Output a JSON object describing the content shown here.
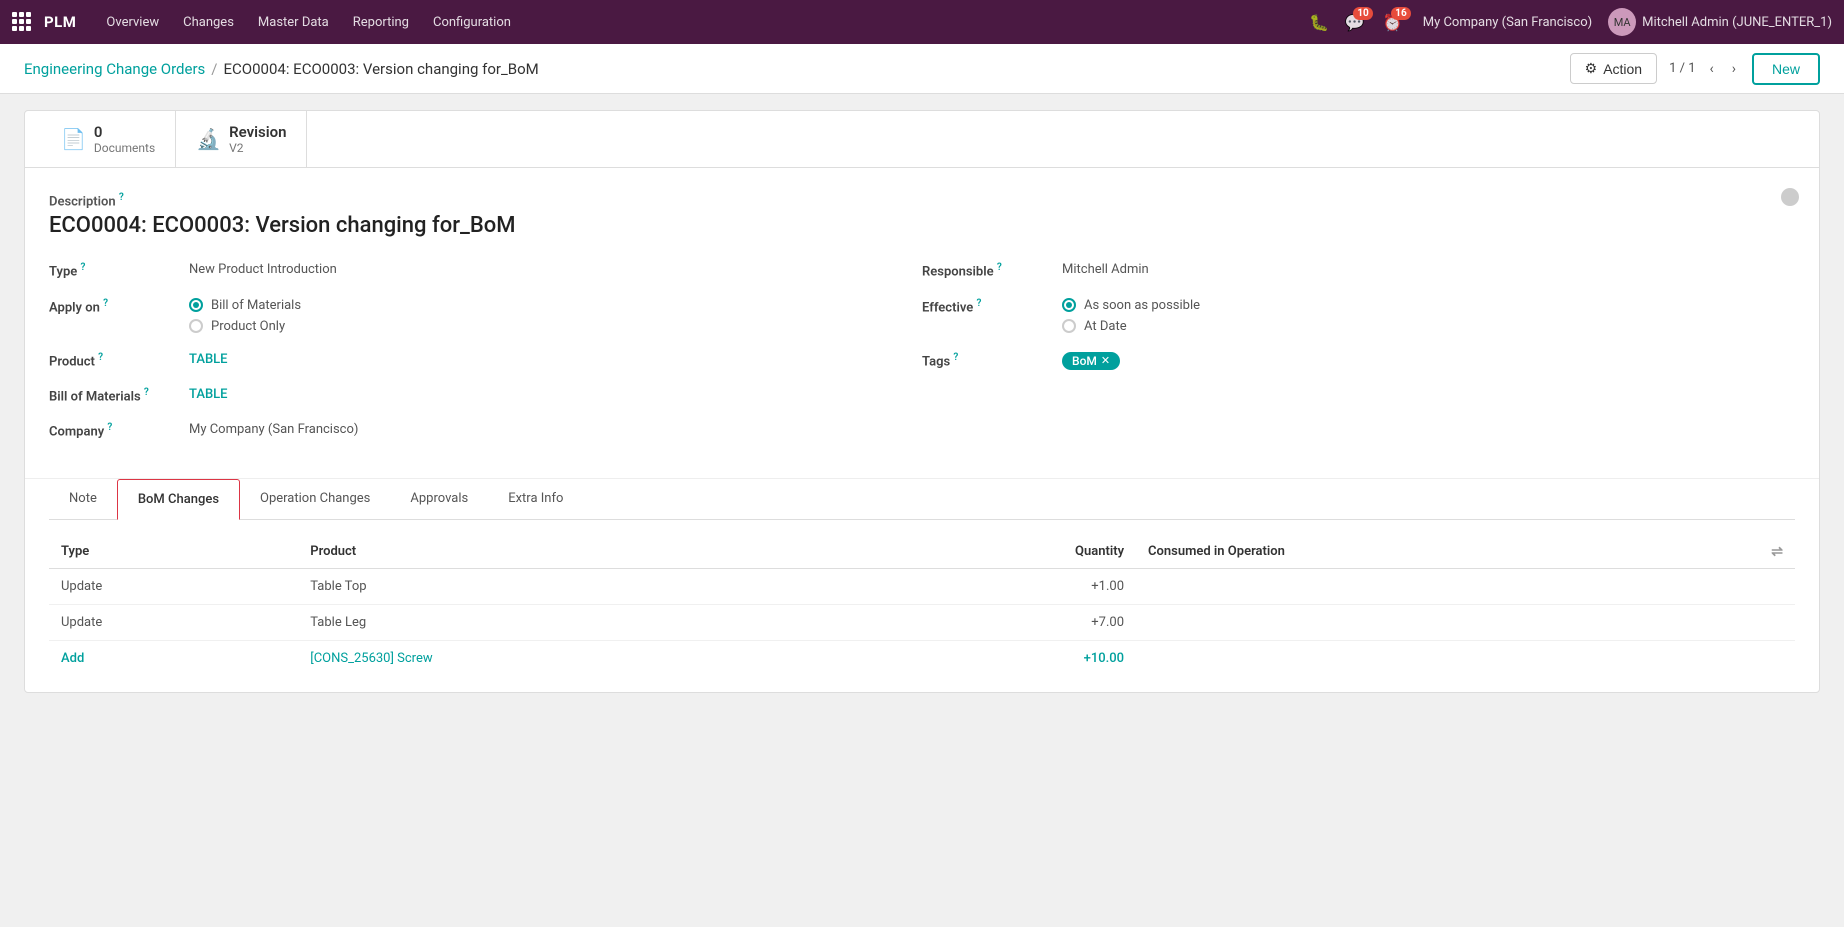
{
  "topnav": {
    "brand": "PLM",
    "links": [
      "Overview",
      "Changes",
      "Master Data",
      "Reporting",
      "Configuration"
    ],
    "messages_badge": "10",
    "alerts_badge": "16",
    "company": "My Company (San Francisco)",
    "user": "Mitchell Admin (JUNE_ENTER_1)"
  },
  "breadcrumb": {
    "parent": "Engineering Change Orders",
    "separator": "/",
    "current": "ECO0004: ECO0003: Version changing for_BoM"
  },
  "toolbar": {
    "action_label": "Action",
    "page_indicator": "1 / 1",
    "new_label": "New"
  },
  "smart_buttons": [
    {
      "icon": "📄",
      "count": "0",
      "label": "Documents"
    },
    {
      "icon": "🔬",
      "count": "Revision",
      "label": "V2"
    }
  ],
  "form": {
    "description_label": "Description",
    "title": "ECO0004: ECO0003: Version changing for_BoM",
    "type_label": "Type",
    "type_value": "New Product Introduction",
    "apply_on_label": "Apply on",
    "apply_options": [
      "Bill of Materials",
      "Product Only"
    ],
    "apply_selected": "Bill of Materials",
    "product_label": "Product",
    "product_value": "TABLE",
    "bom_label": "Bill of Materials",
    "bom_value": "TABLE",
    "company_label": "Company",
    "company_value": "My Company (San Francisco)",
    "responsible_label": "Responsible",
    "responsible_value": "Mitchell Admin",
    "effective_label": "Effective",
    "effective_options": [
      "As soon as possible",
      "At Date"
    ],
    "effective_selected": "As soon as possible",
    "tags_label": "Tags",
    "tags": [
      "BoM"
    ]
  },
  "tabs": [
    {
      "id": "note",
      "label": "Note"
    },
    {
      "id": "bom-changes",
      "label": "BoM Changes",
      "active": true
    },
    {
      "id": "operation-changes",
      "label": "Operation Changes"
    },
    {
      "id": "approvals",
      "label": "Approvals"
    },
    {
      "id": "extra-info",
      "label": "Extra Info"
    }
  ],
  "table": {
    "columns": [
      "Type",
      "Product",
      "Quantity",
      "Consumed in Operation"
    ],
    "rows": [
      {
        "type": "Update",
        "product": "Table Top",
        "quantity": "+1.00",
        "operation": "",
        "is_link": false,
        "is_add": false
      },
      {
        "type": "Update",
        "product": "Table Leg",
        "quantity": "+7.00",
        "operation": "",
        "is_link": false,
        "is_add": false
      },
      {
        "type": "Add",
        "product": "[CONS_25630] Screw",
        "quantity": "+10.00",
        "operation": "",
        "is_link": true,
        "is_add": true
      }
    ]
  }
}
